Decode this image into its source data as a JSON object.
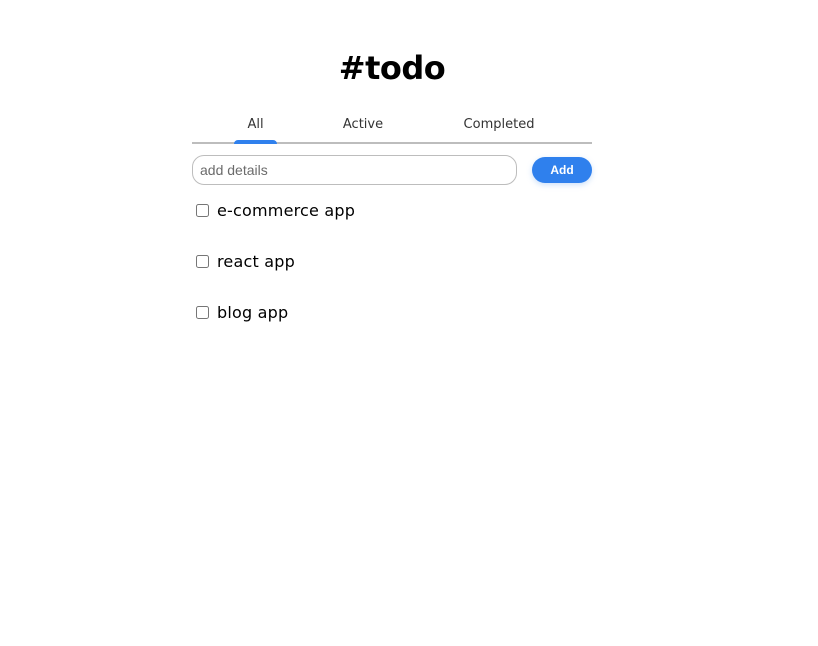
{
  "app": {
    "title": "#todo"
  },
  "tabs": [
    {
      "label": "All",
      "selected": true
    },
    {
      "label": "Active",
      "selected": false
    },
    {
      "label": "Completed",
      "selected": false
    }
  ],
  "input": {
    "placeholder": "add details",
    "value": ""
  },
  "add_button": {
    "label": "Add"
  },
  "todos": [
    {
      "text": "e-commerce app",
      "checked": false
    },
    {
      "text": "react app",
      "checked": false
    },
    {
      "text": "blog app",
      "checked": false
    }
  ],
  "colors": {
    "accent": "#2f80ed",
    "divider": "#bdbdbd",
    "text": "#000000"
  }
}
